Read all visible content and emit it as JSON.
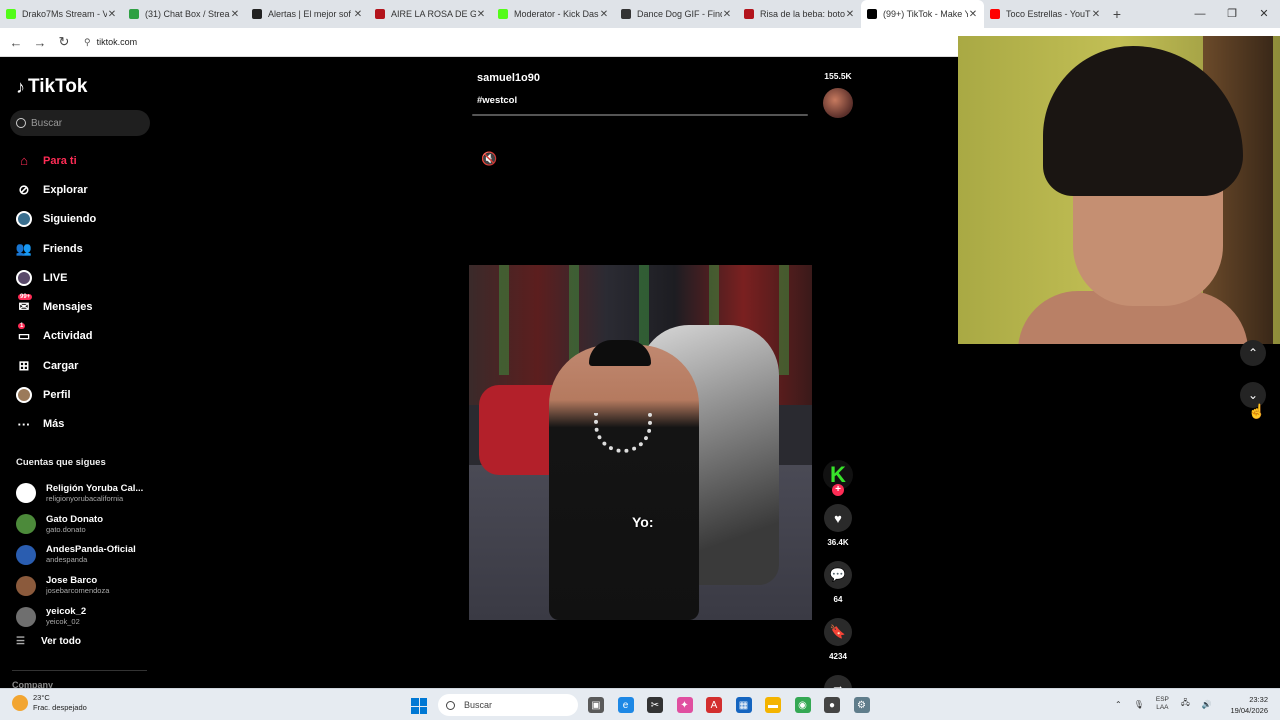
{
  "browser": {
    "tabs": [
      {
        "title": "Drako7Ms Stream - V",
        "icon_color": "#53fc18"
      },
      {
        "title": "(31) Chat Box / Strea",
        "icon_color": "#2ea043"
      },
      {
        "title": "Alertas | El mejor sof",
        "icon_color": "#222222"
      },
      {
        "title": "AIRE LA ROSA DE GU",
        "icon_color": "#b3141c"
      },
      {
        "title": "Moderator - Kick Das",
        "icon_color": "#53fc18"
      },
      {
        "title": "Dance Dog GIF - Find",
        "icon_color": "#333333"
      },
      {
        "title": "Risa de la beba: boto",
        "icon_color": "#b3141c"
      },
      {
        "title": "(99+) TikTok - Make Y",
        "icon_color": "#000000",
        "active": true
      },
      {
        "title": "Toco Estrellas - YouT",
        "icon_color": "#ff0000"
      }
    ],
    "new_tab": "+",
    "url": "tiktok.com",
    "window_controls": {
      "minimize": "—",
      "maximize": "❐",
      "close": "✕"
    }
  },
  "sidebar": {
    "logo": "TikTok",
    "search_placeholder": "Buscar",
    "nav": [
      {
        "label": "Para ti",
        "icon": "home-icon",
        "glyph": "⌂",
        "active": true
      },
      {
        "label": "Explorar",
        "icon": "compass-icon",
        "glyph": "⊘"
      },
      {
        "label": "Siguiendo",
        "icon": "following-icon",
        "glyph": ""
      },
      {
        "label": "Friends",
        "icon": "friends-icon",
        "glyph": "👥"
      },
      {
        "label": "LIVE",
        "icon": "live-icon",
        "glyph": ""
      },
      {
        "label": "Mensajes",
        "icon": "messages-icon",
        "glyph": "✉",
        "badge": "99+"
      },
      {
        "label": "Actividad",
        "icon": "activity-icon",
        "glyph": "▭",
        "badge": "1"
      },
      {
        "label": "Cargar",
        "icon": "upload-icon",
        "glyph": "⊞"
      },
      {
        "label": "Perfil",
        "icon": "profile-icon",
        "glyph": ""
      },
      {
        "label": "Más",
        "icon": "more-icon",
        "glyph": "···"
      }
    ],
    "following_title": "Cuentas que sigues",
    "accounts": [
      {
        "name": "Religión Yoruba Cal...",
        "handle": "religionyorubacalifornia",
        "color": "#ffffff"
      },
      {
        "name": "Gato Donato",
        "handle": "gato.donato",
        "color": "#4c8a3a"
      },
      {
        "name": "AndesPanda-Oficial",
        "handle": "andespanda",
        "color": "#2a5db0"
      },
      {
        "name": "Jose Barco",
        "handle": "josebarcomendoza",
        "color": "#8b5a3c"
      },
      {
        "name": "yeicok_2",
        "handle": "yeicok_02",
        "color": "#6f6f6f"
      }
    ],
    "see_all": "Ver todo",
    "company": "Company"
  },
  "feed": {
    "prev": {
      "username": "samuel1o90",
      "hashtag": "#westcol",
      "share_count": "155.5K"
    },
    "video": {
      "caption": "Yo:"
    },
    "actions": {
      "creator_initial": "K",
      "likes": "36.4K",
      "comments": "64",
      "saves": "4234"
    }
  },
  "taskbar": {
    "temp": "23°C",
    "weather": "Frac. despejado",
    "search": "Buscar",
    "lang_top": "ESP",
    "lang_bottom": "LAA",
    "time": "23:32",
    "date": "19/04/2026"
  }
}
